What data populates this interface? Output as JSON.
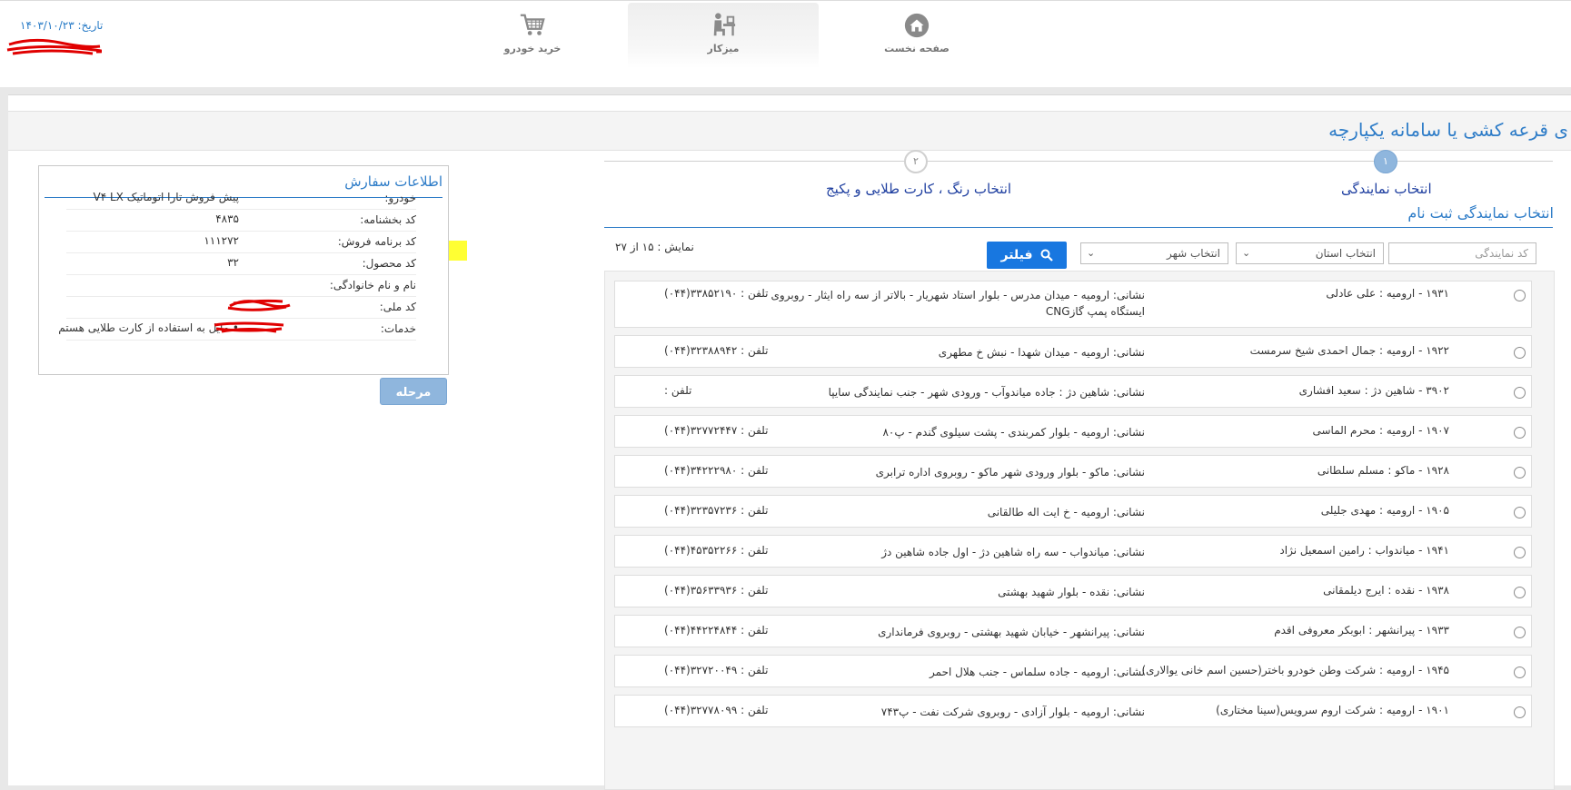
{
  "header": {
    "date_label": "تاریخ: ۱۴۰۳/۱۰/۲۳",
    "nav": [
      {
        "label": "صفحه نخست",
        "icon": "home-icon"
      },
      {
        "label": "میزکار",
        "icon": "desk-person-icon"
      },
      {
        "label": "خرید خودرو",
        "icon": "cart-icon"
      }
    ]
  },
  "page": {
    "title": "ی قرعه کشی یا سامانه یکپارچه"
  },
  "wizard": {
    "steps": [
      {
        "number": "۱",
        "label": "انتخاب نمایندگی"
      },
      {
        "number": "۲",
        "label": "انتخاب رنگ ، کارت طلایی و پکیج"
      }
    ],
    "section_title": "انتخاب نمایندگی ثبت نام"
  },
  "filters": {
    "agent_code_placeholder": "کد نمایندگی",
    "state_select": "انتخاب استان",
    "city_select": "انتخاب شهر",
    "filter_button": "فیلتر",
    "count_text": "نمایش : ۱۵ از ۲۷"
  },
  "order": {
    "title": "اطلاعات سفارش",
    "rows": [
      {
        "key": "خودرو:",
        "value": "پیش فروش تارا اتوماتیک V۴ LX"
      },
      {
        "key": "کد بخشنامه:",
        "value": "۴۸۳۵"
      },
      {
        "key": "کد برنامه فروش:",
        "value": "۱۱۱۲۷۲"
      },
      {
        "key": "کد محصول:",
        "value": "۳۲"
      },
      {
        "key": "نام و نام خانوادگی:",
        "value": ""
      },
      {
        "key": "کد ملی:",
        "value": ""
      },
      {
        "key": "خدمات:",
        "value": "• مایل به استفاده از کارت طلایی هستم"
      }
    ],
    "next_button": "مرحله بعد"
  },
  "dealers": [
    {
      "name": "۱۹۳۱ - ارومیه : علی عادلی",
      "address": "نشانی: ارومیه - میدان مدرس - بلوار استاد شهریار - بالاتر از سه راه ایثار - روبروی ایستگاه پمپ گازCNG",
      "phone": "تلفن : ۳۳۸۵۲۱۹۰(۰۴۴)"
    },
    {
      "name": "۱۹۲۲ - ارومیه : جمال احمدی شیخ سرمست",
      "address": "نشانی: ارومیه - میدان شهدا - نبش خ مطهری",
      "phone": "تلفن : ۳۲۳۸۸۹۴۲(۰۴۴)"
    },
    {
      "name": "۳۹۰۲ - شاهین دژ : سعید افشاری",
      "address": "نشانی: شاهین دژ : جاده میاندوآب - ورودی شهر - جنب نمایندگی سایپا",
      "phone": "تلفن :"
    },
    {
      "name": "۱۹۰۷ - ارومیه : محرم الماسی",
      "address": "نشانی: ارومیه - بلوار کمربندی - پشت سیلوی گندم - پ۸۰",
      "phone": "تلفن : ۳۲۷۷۲۴۴۷(۰۴۴)"
    },
    {
      "name": "۱۹۲۸ - ماکو : مسلم سلطانی",
      "address": "نشانی: ماکو - بلوار ورودی شهر ماکو - روبروی اداره ترابری",
      "phone": "تلفن : ۳۴۲۲۲۹۸۰(۰۴۴)"
    },
    {
      "name": "۱۹۰۵ - ارومیه : مهدی جلیلی",
      "address": "نشانی: ارومیه - خ ایت اله طالقانی",
      "phone": "تلفن : ۳۲۳۵۷۲۳۶(۰۴۴)"
    },
    {
      "name": "۱۹۴۱ - میاندواب : رامین اسمعیل نژاد",
      "address": "نشانی: میاندواب - سه راه شاهین دژ - اول جاده شاهین دژ",
      "phone": "تلفن : ۴۵۳۵۲۲۶۶(۰۴۴)"
    },
    {
      "name": "۱۹۳۸ - نقده : ایرج دیلمقانی",
      "address": "نشانی: نقده - بلوار شهید بهشتی",
      "phone": "تلفن : ۳۵۶۳۳۹۳۶(۰۴۴)"
    },
    {
      "name": "۱۹۳۳ - پیرانشهر : ابوبکر معروفی اقدم",
      "address": "نشانی: پیرانشهر - خیابان شهید بهشتی - روبروی فرمانداری",
      "phone": "تلفن : ۴۴۲۲۴۸۴۴(۰۴۴)"
    },
    {
      "name": "۱۹۴۵ - ارومیه : شرکت وطن خودرو باختر(حسین اسم خانی یوالاری)",
      "address": "نشانی: ارومیه - جاده سلماس - جنب هلال احمر",
      "phone": "تلفن : ۳۲۷۲۰۰۴۹(۰۴۴)"
    },
    {
      "name": "۱۹۰۱ - ارومیه : شرکت اروم سرویس(سینا مختاری)",
      "address": "نشانی: ارومیه - بلوار آزادی - روبروی شرکت نفت - پ۷۴۳",
      "phone": "تلفن : ۳۲۷۷۸۰۹۹(۰۴۴)"
    }
  ]
}
